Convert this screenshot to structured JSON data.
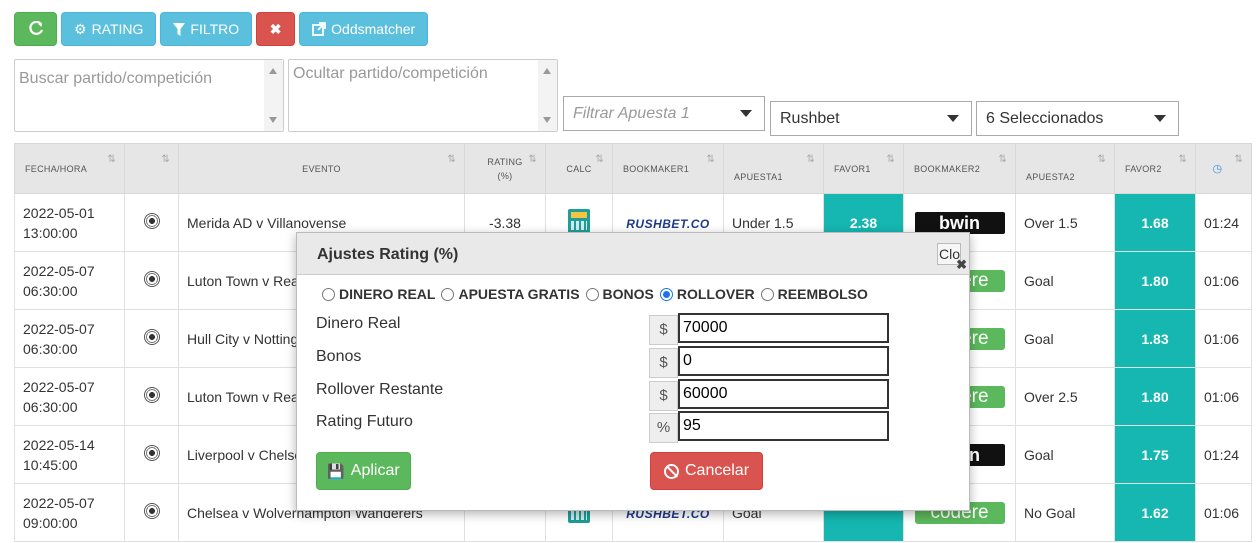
{
  "toolbar": {
    "refresh_icon": "refresh-icon",
    "rating_label": "RATING",
    "filter_label": "FILTRO",
    "clear_label": "✖",
    "oddsmatcher_label": "Oddsmatcher"
  },
  "filters": {
    "search_placeholder": "Buscar partido/competición",
    "hide_placeholder": "Ocultar partido/competición",
    "bet_filter_placeholder": "Filtrar Apuesta 1",
    "bookmaker_selected": "Rushbet",
    "multi_selected": "6 Seleccionados"
  },
  "table": {
    "headers": {
      "fecha": "FECHA/HORA",
      "evento": "EVENTO",
      "rating": "RATING",
      "rating_unit": "(%)",
      "calc": "CALC",
      "bookmaker1": "BOOKMAKER1",
      "apuesta1": "APUESTA1",
      "favor1": "FAVOR1",
      "bookmaker2": "BOOKMAKER2",
      "apuesta2": "APUESTA2",
      "favor2": "FAVOR2"
    },
    "rows": [
      {
        "date": "2022-05-01",
        "time": "13:00:00",
        "event": "Merida AD v Villanovense",
        "rating": "-3.38",
        "bookmaker1": "RUSHBET.CO",
        "bet1": "Under 1.5",
        "favor1": "2.38",
        "bookmaker2": "bwin",
        "bet2": "Over 1.5",
        "favor2": "1.68",
        "remaining": "01:24"
      },
      {
        "date": "2022-05-07",
        "time": "06:30:00",
        "event": "Luton Town v Reading",
        "rating": "",
        "bookmaker1": "",
        "bet1": "",
        "favor1": "",
        "bookmaker2": "codere",
        "bet2": "Goal",
        "favor2": "1.80",
        "remaining": "01:06"
      },
      {
        "date": "2022-05-07",
        "time": "06:30:00",
        "event": "Hull City v Nottingham",
        "rating": "",
        "bookmaker1": "",
        "bet1": "",
        "favor1": "",
        "bookmaker2": "codere",
        "bet2": "Goal",
        "favor2": "1.83",
        "remaining": "01:06"
      },
      {
        "date": "2022-05-07",
        "time": "06:30:00",
        "event": "Luton Town v Reading",
        "rating": "",
        "bookmaker1": "",
        "bet1": "",
        "favor1": "",
        "bookmaker2": "codere",
        "bet2": "Over 2.5",
        "favor2": "1.80",
        "remaining": "01:06"
      },
      {
        "date": "2022-05-14",
        "time": "10:45:00",
        "event": "Liverpool v Chelsea",
        "rating": "",
        "bookmaker1": "",
        "bet1": "",
        "favor1": "",
        "bookmaker2": "bwin",
        "bet2": "Goal",
        "favor2": "1.75",
        "remaining": "01:24"
      },
      {
        "date": "2022-05-07",
        "time": "09:00:00",
        "event": "Chelsea v Wolverhampton Wanderers",
        "rating": "",
        "bookmaker1": "RUSHBET.CO",
        "bet1": "Goal",
        "favor1": "",
        "bookmaker2": "codere",
        "bet2": "No Goal",
        "favor2": "1.62",
        "remaining": "01:06"
      }
    ]
  },
  "modal": {
    "title": "Ajustes Rating (%)",
    "close_label": "Close",
    "close_x": "✖",
    "radios": [
      {
        "label": "DINERO REAL",
        "checked": false
      },
      {
        "label": "APUESTA GRATIS",
        "checked": false
      },
      {
        "label": "BONOS",
        "checked": false
      },
      {
        "label": "ROLLOVER",
        "checked": true
      },
      {
        "label": "REEMBOLSO",
        "checked": false
      }
    ],
    "fields": [
      {
        "label": "Dinero Real",
        "addon": "$",
        "value": "70000"
      },
      {
        "label": "Bonos",
        "addon": "$",
        "value": "0"
      },
      {
        "label": "Rollover Restante",
        "addon": "$",
        "value": "60000"
      },
      {
        "label": "Rating Futuro",
        "addon": "%",
        "value": "95"
      }
    ],
    "apply_label": "Aplicar",
    "cancel_label": "Cancelar"
  },
  "colors": {
    "accent_green": "#5cb85c",
    "accent_info": "#5bc0de",
    "danger": "#d9534f",
    "favor_teal": "#15b7b0"
  }
}
